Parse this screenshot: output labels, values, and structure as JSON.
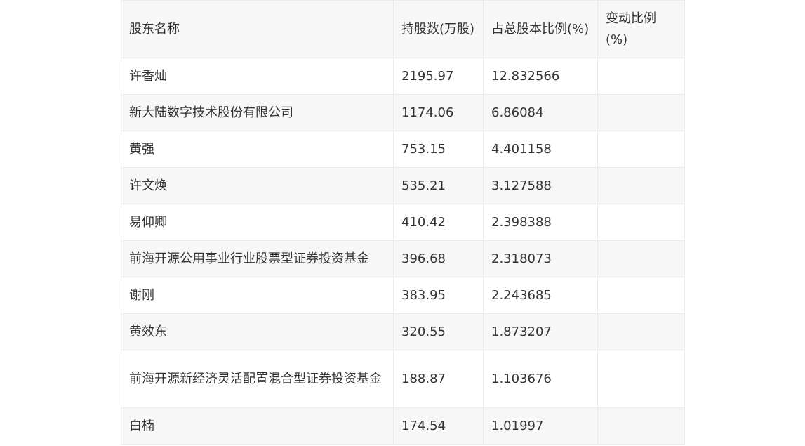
{
  "table": {
    "headers": [
      "股东名称",
      "持股数(万股)",
      "占总股本比例(%)",
      "变动比例(%)"
    ],
    "rows": [
      {
        "name": "许香灿",
        "shares": "2195.97",
        "ratio": "12.832566",
        "change": ""
      },
      {
        "name": "新大陆数字技术股份有限公司",
        "shares": "1174.06",
        "ratio": "6.86084",
        "change": ""
      },
      {
        "name": "黄强",
        "shares": "753.15",
        "ratio": "4.401158",
        "change": ""
      },
      {
        "name": "许文焕",
        "shares": "535.21",
        "ratio": "3.127588",
        "change": ""
      },
      {
        "name": "易仰卿",
        "shares": "410.42",
        "ratio": "2.398388",
        "change": ""
      },
      {
        "name": "前海开源公用事业行业股票型证券投资基金",
        "shares": "396.68",
        "ratio": "2.318073",
        "change": ""
      },
      {
        "name": "谢刚",
        "shares": "383.95",
        "ratio": "2.243685",
        "change": ""
      },
      {
        "name": "黄效东",
        "shares": "320.55",
        "ratio": "1.873207",
        "change": ""
      },
      {
        "name": "前海开源新经济灵活配置混合型证券投资基金",
        "shares": "188.87",
        "ratio": "1.103676",
        "change": ""
      },
      {
        "name": "白楠",
        "shares": "174.54",
        "ratio": "1.01997",
        "change": ""
      }
    ]
  }
}
